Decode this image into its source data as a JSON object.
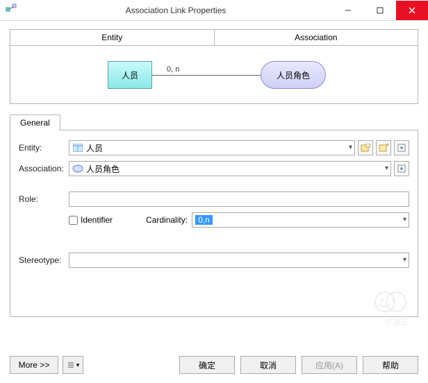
{
  "window": {
    "title": "Association Link Properties"
  },
  "topTabs": {
    "entity": "Entity",
    "association": "Association"
  },
  "diagram": {
    "entityLabel": "人员",
    "assocLabel": "人员角色",
    "cardinality": "0, n"
  },
  "tab": {
    "general": "General"
  },
  "form": {
    "entityLabel": "Entity:",
    "entityValue": "人员",
    "assocLabel": "Association:",
    "assocValue": "人员角色",
    "roleLabel": "Role:",
    "roleValue": "",
    "identifierLabel": "Identifier",
    "cardinalityLabel": "Cardinality:",
    "cardinalityValue": "0,n",
    "stereotypeLabel": "Stereotype:",
    "stereotypeValue": ""
  },
  "buttons": {
    "more": "More >>",
    "ok": "确定",
    "cancel": "取消",
    "apply": "应用(A)",
    "help": "帮助"
  },
  "watermark": "亿速云"
}
